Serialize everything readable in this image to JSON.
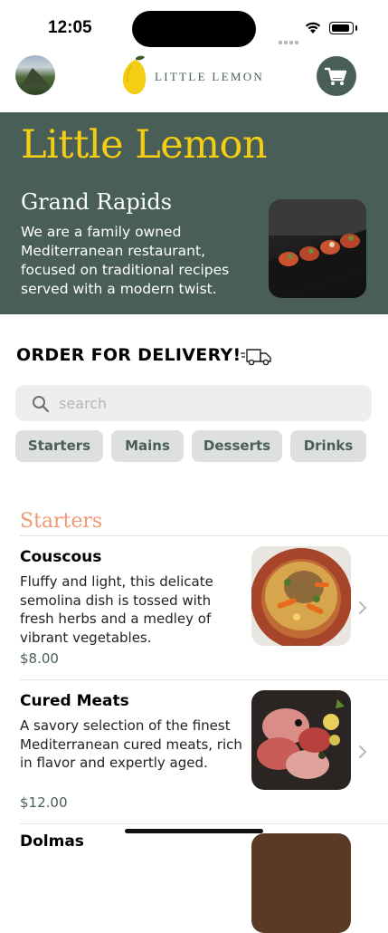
{
  "status_bar": {
    "time": "12:05"
  },
  "header": {
    "logo_text": "LITTLE LEMON"
  },
  "hero": {
    "title": "Little Lemon",
    "city": "Grand Rapids",
    "description": "We are a family owned Mediterranean restaurant, focused on traditional recipes served with a modern twist."
  },
  "order": {
    "heading": "ORDER FOR DELIVERY!"
  },
  "search": {
    "placeholder": "search",
    "value": ""
  },
  "categories": [
    "Starters",
    "Mains",
    "Desserts",
    "Drinks"
  ],
  "menu": {
    "section": "Starters",
    "items": [
      {
        "name": "Couscous",
        "description": "Fluffy and light, this delicate semolina dish is tossed with fresh herbs and a medley of vibrant vegetables.",
        "price": "$8.00"
      },
      {
        "name": "Cured Meats",
        "description": "A savory selection of the finest Mediterranean cured meats, rich in flavor and expertly aged.",
        "price": "$12.00"
      },
      {
        "name": "Dolmas"
      }
    ]
  },
  "colors": {
    "primary": "#495e57",
    "accent": "#f4ce14",
    "section": "#ee9972"
  }
}
